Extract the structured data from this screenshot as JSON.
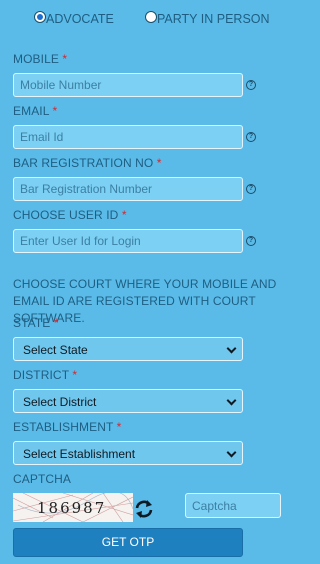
{
  "user_type": {
    "options": [
      {
        "label": "ADVOCATE",
        "selected": true
      },
      {
        "label": "PARTY IN PERSON",
        "selected": false
      }
    ]
  },
  "fields": {
    "mobile": {
      "label": "MOBILE",
      "required": "*",
      "placeholder": "Mobile Number"
    },
    "email": {
      "label": "EMAIL",
      "required": "*",
      "placeholder": "Email Id"
    },
    "bar_reg": {
      "label": "BAR REGISTRATION NO",
      "required": "*",
      "placeholder": "Bar Registration Number"
    },
    "user_id": {
      "label": "CHOOSE USER ID",
      "required": "*",
      "placeholder": "Enter User Id for Login"
    }
  },
  "help_icon_glyph": "?",
  "court_note": "CHOOSE COURT WHERE YOUR MOBILE AND EMAIL ID ARE REGISTERED WITH COURT SOFTWARE.",
  "selects": {
    "state": {
      "label": "STATE",
      "required": "*",
      "value": "Select State"
    },
    "district": {
      "label": "DISTRICT",
      "required": "*",
      "value": "Select District"
    },
    "establishment": {
      "label": "ESTABLISHMENT",
      "required": "*",
      "value": "Select Establishment"
    }
  },
  "captcha": {
    "label": "CAPTCHA",
    "image_text": "186987",
    "input_placeholder": "Captcha",
    "refresh_icon": "refresh-arrows-icon"
  },
  "submit": {
    "label": "GET OTP"
  },
  "colors": {
    "background": "#5bbbe8",
    "label_text": "#1f5e82",
    "required": "#d8262b",
    "button": "#1f80bf"
  }
}
